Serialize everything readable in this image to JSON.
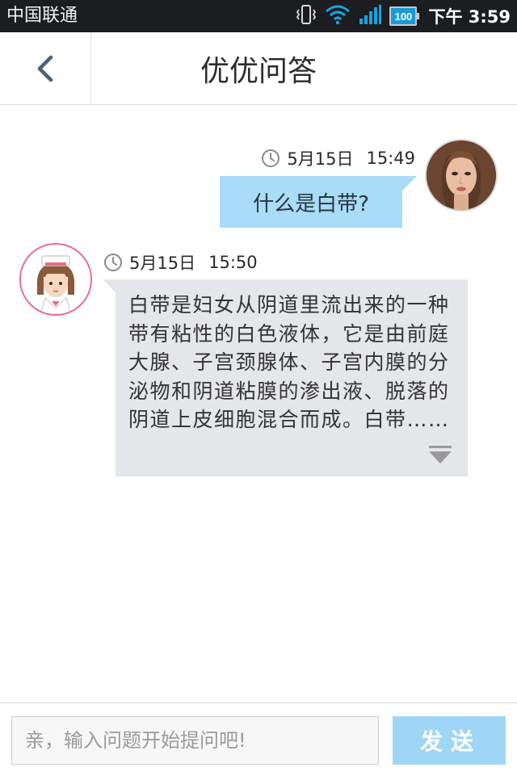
{
  "status_bar": {
    "carrier": "中国联通",
    "battery": "100",
    "time": "下午 3:59"
  },
  "nav": {
    "title": "优优问答"
  },
  "messages": [
    {
      "sender": "user",
      "date": "5月15日",
      "time": "15:49",
      "text": "什么是白带?"
    },
    {
      "sender": "nurse",
      "date": "5月15日",
      "time": "15:50",
      "text": "白带是妇女从阴道里流出来的一种带有粘性的白色液体，它是由前庭大腺、子宫颈腺体、子宫内膜的分泌物和阴道粘膜的渗出液、脱落的阴道上皮细胞混合而成。白带……"
    }
  ],
  "input": {
    "placeholder": "亲，输入问题开始提问吧!",
    "value": "",
    "send_label": "发送"
  },
  "colors": {
    "accent": "#9fd6f5",
    "user_bubble": "#a8dcf7",
    "nurse_bubble": "#e4e6e9",
    "nurse_avatar_ring": "#e86b8d",
    "status_bar": "#1b1d20"
  },
  "icons": {
    "back": "chevron-left-icon",
    "clock": "clock-icon",
    "expand": "expand-down-icon",
    "vibrate": "vibrate-icon",
    "wifi": "wifi-icon",
    "signal": "signal-icon",
    "battery": "battery-icon"
  }
}
